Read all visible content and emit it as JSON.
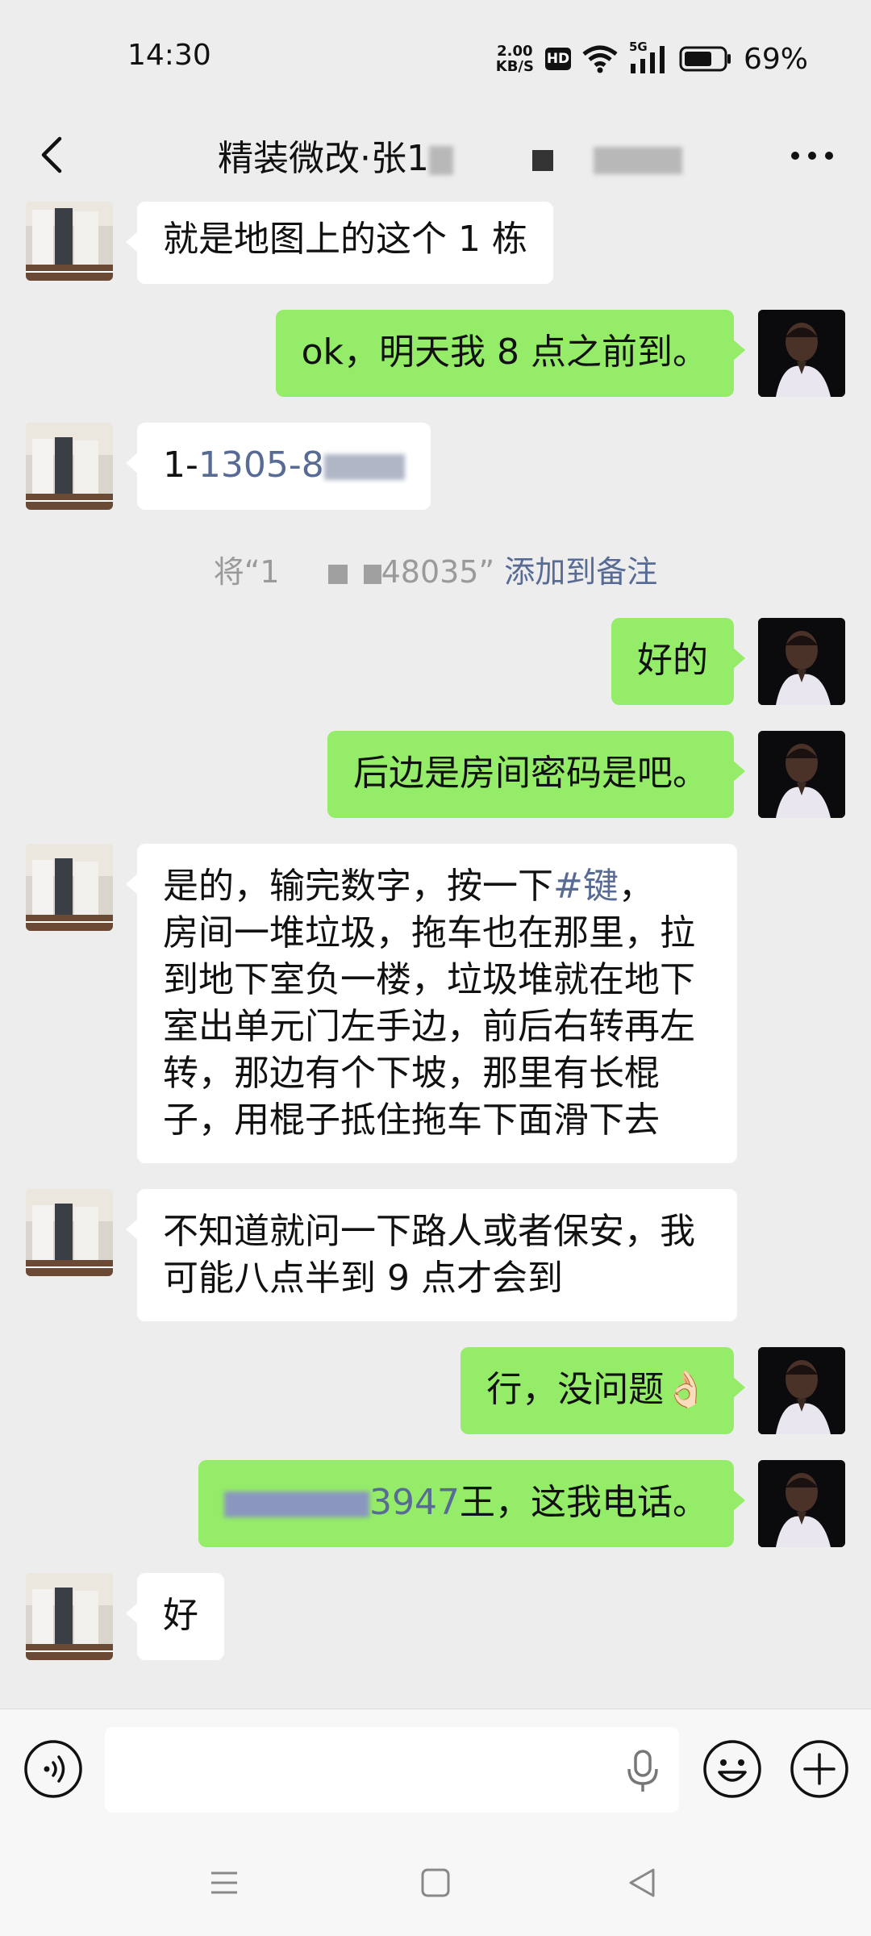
{
  "status_bar": {
    "time": "14:30",
    "net_speed_value": "2.00",
    "net_speed_unit": "KB/S",
    "hd_label": "HD",
    "signal_label": "5G",
    "battery": "69%"
  },
  "header": {
    "title_visible": "精装微改·张1"
  },
  "messages": [
    {
      "from": "other",
      "text": "就是地图上的这个 1 栋"
    },
    {
      "from": "me",
      "text": "ok，明天我 8 点之前到。"
    },
    {
      "from": "other",
      "prefix": "1-",
      "link_text": "1305-8"
    },
    {
      "from": "system",
      "prefix": "将“1",
      "mid": "48035”",
      "link_text": "添加到备注"
    },
    {
      "from": "me",
      "text": "好的"
    },
    {
      "from": "me",
      "text": "后边是房间密码是吧。"
    },
    {
      "from": "other",
      "lines": [
        "是的，输完数字，按一下",
        "房间一堆垃圾，拖车也在那里，拉",
        "到地下室负一楼，垃圾堆就在地下",
        "室出单元门左手边，前后右转再左",
        "转，那边有个下坡，那里有长棍",
        "子，用棍子抵住拖车下面滑下去"
      ],
      "link_text": "#键",
      "link_suffix": "，"
    },
    {
      "from": "other",
      "lines": [
        "不知道就问一下路人或者保安，我",
        "可能八点半到 9 点才会到"
      ]
    },
    {
      "from": "me",
      "text": "行，没问题",
      "emoji": "👌🏻"
    },
    {
      "from": "me",
      "link_text": "3947",
      "text": "王，这我电话。"
    },
    {
      "from": "other",
      "text": "好"
    }
  ],
  "icons": [
    "back-icon",
    "more-icon",
    "voice-icon",
    "mic-icon",
    "emoji-icon",
    "plus-icon",
    "menu-nav-icon",
    "home-nav-icon",
    "back-nav-icon"
  ]
}
